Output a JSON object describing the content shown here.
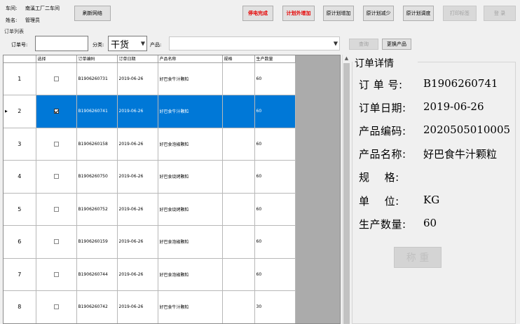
{
  "header": {
    "workshop_label": "车间:",
    "workshop_value": "南溪工厂二车间",
    "name_label": "姓名:",
    "name_value": "管理员",
    "refresh_button": "刷新网络"
  },
  "toolbar": {
    "power_off_done": "停电完成",
    "plan_add": "计划外增加",
    "plan_increase": "原计划增加",
    "plan_decrease": "原计划减少",
    "plan_adjust": "原计划调度",
    "print_label": "打印标签",
    "login": "登 录"
  },
  "order_list_label": "订单列表",
  "filters": {
    "order_no_label": "订单号:",
    "order_no_value": "",
    "category_label": "分类:",
    "category_value": "干货",
    "product_label": "产品:",
    "product_value": "",
    "query_button": "查询",
    "change_product_button": "更换产品"
  },
  "grid": {
    "columns": [
      "",
      "选择",
      "订单编码",
      "订单日期",
      "产品名称",
      "规格",
      "生产数量"
    ],
    "rows": [
      {
        "index": "1",
        "checked": false,
        "order_code": "B1906260731",
        "date": "2019-06-26",
        "product": "好巴食牛汁颗粒",
        "spec": "",
        "qty": "60",
        "selected": false
      },
      {
        "index": "2",
        "checked": true,
        "order_code": "B1906260741",
        "date": "2019-06-26",
        "product": "好巴食牛汁颗粒",
        "spec": "",
        "qty": "60",
        "selected": true
      },
      {
        "index": "3",
        "checked": false,
        "order_code": "B1906260158",
        "date": "2019-06-26",
        "product": "好巴食泡椒颗粒",
        "spec": "",
        "qty": "60",
        "selected": false
      },
      {
        "index": "4",
        "checked": false,
        "order_code": "B1906260750",
        "date": "2019-06-26",
        "product": "好巴食烧烤颗粒",
        "spec": "",
        "qty": "60",
        "selected": false
      },
      {
        "index": "5",
        "checked": false,
        "order_code": "B1906260752",
        "date": "2019-06-26",
        "product": "好巴食烧烤颗粒",
        "spec": "",
        "qty": "60",
        "selected": false
      },
      {
        "index": "6",
        "checked": false,
        "order_code": "B1906260159",
        "date": "2019-06-26",
        "product": "好巴食泡椒颗粒",
        "spec": "",
        "qty": "60",
        "selected": false
      },
      {
        "index": "7",
        "checked": false,
        "order_code": "B1906260744",
        "date": "2019-06-26",
        "product": "好巴食泡椒颗粒",
        "spec": "",
        "qty": "60",
        "selected": false
      },
      {
        "index": "8",
        "checked": false,
        "order_code": "B1906260742",
        "date": "2019-06-26",
        "product": "好巴食牛汁颗粒",
        "spec": "",
        "qty": "30",
        "selected": false
      }
    ]
  },
  "detail": {
    "title": "订单详情",
    "order_no_label": "订 单 号:",
    "order_no_value": "B1906260741",
    "order_date_label": "订单日期:",
    "order_date_value": "2019-06-26",
    "product_code_label": "产品编码:",
    "product_code_value": "2020505010005",
    "product_name_label": "产品名称:",
    "product_name_value": "好巴食牛汁颗粒",
    "spec_label": "规    格:",
    "spec_value": "",
    "unit_label": "单    位:",
    "unit_value": "KG",
    "qty_label": "生产数量:",
    "qty_value": "60",
    "weigh_button": "称 重"
  },
  "colors": {
    "selection": "#0078d7",
    "row_header_selected": "#cce4f7",
    "alert_text": "#e60000",
    "grid_bg": "#ababab"
  }
}
